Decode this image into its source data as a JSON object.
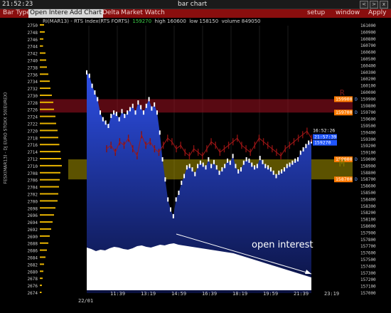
{
  "window": {
    "clock": "21:52:23",
    "title": "bar chart",
    "controls": [
      "<",
      ">",
      "x"
    ]
  },
  "menu": {
    "left": [
      "Bar Type",
      "Open Interest",
      "Add Chart",
      "Delta",
      "Market Watch"
    ],
    "selected": [
      "Open Interest",
      "Add Chart"
    ],
    "right": [
      "setup",
      "window",
      "Apply"
    ]
  },
  "info": {
    "symbol": "RI(MAR13) - RTS Index(RTS FORTS)",
    "last": "159270",
    "high_label": "high",
    "high": "160600",
    "low_label": "low",
    "low": "158150",
    "volume_label": "volume",
    "volume": "849050"
  },
  "side_label": "FESX(MAR13) - DJ EURO STOXX 50(EUREX)",
  "annotation": "open interest",
  "zones": {
    "upper": "R",
    "middle": "M"
  },
  "colors": {
    "accent": "#8a0e0e",
    "price_blue": "#2748d8",
    "zone_red": "#a01020",
    "zone_yellow": "#b8a400",
    "label_orange": "#ff7a00"
  },
  "chart_data": {
    "type": "bar",
    "left_axis": {
      "ticks": [
        2750,
        2748,
        2746,
        2744,
        2742,
        2740,
        2738,
        2736,
        2734,
        2732,
        2730,
        2728,
        2726,
        2724,
        2722,
        2720,
        2718,
        2716,
        2714,
        2712,
        2710,
        2708,
        2706,
        2704,
        2702,
        2700,
        2698,
        2696,
        2694,
        2692,
        2690,
        2688,
        2686,
        2684,
        2682,
        2680,
        2678,
        2676,
        2674
      ]
    },
    "right_axis": {
      "ticks": [
        161000,
        160900,
        160800,
        160700,
        160600,
        160500,
        160400,
        160300,
        160200,
        160100,
        160000,
        159900,
        159800,
        159700,
        159600,
        159500,
        159400,
        159300,
        159200,
        159100,
        159000,
        158900,
        158800,
        158700,
        158600,
        158500,
        158400,
        158300,
        158200,
        158100,
        158000,
        157900,
        157800,
        157700,
        157600,
        157500,
        157400,
        157300,
        157200,
        157100,
        157000
      ]
    },
    "x_axis": {
      "date_label": "22/01",
      "ticks": [
        "11:39",
        "13:19",
        "14:59",
        "16:39",
        "18:19",
        "19:59",
        "21:39",
        "23:19"
      ]
    },
    "level_labels": {
      "r_top": "159900",
      "r_bottom": "159700",
      "m_top": "159000",
      "m_bottom": "158700",
      "current_time": "16:52:26",
      "current_secondary": "21:57:39",
      "current_price": "159270"
    },
    "price_series": [
      160300,
      160250,
      160100,
      160000,
      159900,
      159700,
      159600,
      159550,
      159500,
      159650,
      159700,
      159680,
      159600,
      159720,
      159650,
      159700,
      159750,
      159800,
      159700,
      159850,
      159780,
      159700,
      159800,
      159900,
      159760,
      159820,
      159700,
      159400,
      159000,
      158700,
      158400,
      158250,
      158150,
      158400,
      158500,
      158650,
      158750,
      158880,
      158900,
      158850,
      158780,
      158900,
      158950,
      158920,
      158880,
      159000,
      158900,
      158960,
      158880,
      158800,
      158850,
      158900,
      158980,
      158950,
      159050,
      158900,
      158820,
      158850,
      158950,
      159000,
      158980,
      158920,
      158880,
      158900,
      159020,
      158960,
      158900,
      158880,
      158850,
      158800,
      158750,
      158800,
      158820,
      158850,
      158900,
      158920,
      158950,
      158980,
      159000,
      159100,
      159150,
      159200,
      159250,
      159270
    ],
    "secondary_series": [
      2715,
      2716,
      2714,
      2717,
      2716,
      2718,
      2715,
      2713,
      2719,
      2716,
      2717,
      2715,
      2714,
      2716,
      2718,
      2717,
      2715,
      2716,
      2714,
      2713,
      2715,
      2714,
      2713,
      2715,
      2717,
      2716,
      2714,
      2715,
      2716,
      2717,
      2718,
      2716,
      2715,
      2714,
      2716,
      2718,
      2717,
      2716,
      2715,
      2714,
      2713,
      2715,
      2716,
      2717,
      2718,
      2719,
      2720,
      2718
    ],
    "open_interest": [
      60,
      58,
      55,
      57,
      56,
      59,
      61,
      60,
      58,
      57,
      59,
      62,
      63,
      61,
      60,
      62,
      64,
      63,
      65,
      66,
      64,
      63,
      62,
      61,
      60,
      59,
      58,
      57,
      56,
      55,
      54,
      53,
      52,
      50,
      48,
      46,
      44,
      42,
      40,
      38,
      36,
      34,
      32,
      30,
      28,
      26,
      24,
      22,
      20,
      18
    ],
    "profile_bars": [
      12,
      14,
      10,
      9,
      16,
      18,
      20,
      24,
      28,
      30,
      34,
      38,
      40,
      44,
      46,
      50,
      52,
      55,
      58,
      60,
      62,
      58,
      56,
      54,
      52,
      50,
      44,
      40,
      36,
      32,
      28,
      24,
      20,
      16,
      12,
      10,
      8,
      6,
      5
    ]
  }
}
